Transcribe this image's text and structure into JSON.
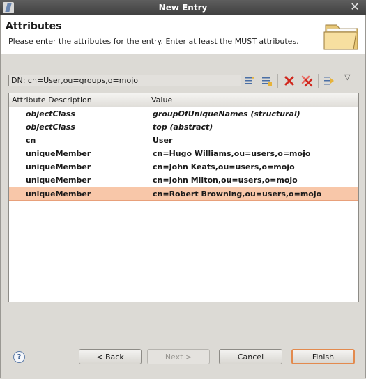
{
  "window": {
    "title": "New Entry",
    "close_glyph": "✕"
  },
  "header": {
    "title": "Attributes",
    "description": "Please enter the attributes for the entry. Enter at least the MUST attributes."
  },
  "dn": {
    "text": "DN: cn=User,ou=groups,o=mojo"
  },
  "toolbar": {
    "icons": [
      "new-attribute-icon",
      "edit-attribute-icon",
      "delete-icon",
      "delete-all-icon",
      "filter-icon",
      "view-menu-icon"
    ],
    "menu_glyph": "▽"
  },
  "table": {
    "columns": [
      "Attribute Description",
      "Value"
    ],
    "rows": [
      {
        "attribute": "objectClass",
        "value": "groupOfUniqueNames (structural)",
        "italic": true
      },
      {
        "attribute": "objectClass",
        "value": "top (abstract)",
        "italic": true
      },
      {
        "attribute": "cn",
        "value": "User",
        "italic": false
      },
      {
        "attribute": "uniqueMember",
        "value": "cn=Hugo Williams,ou=users,o=mojo",
        "italic": false
      },
      {
        "attribute": "uniqueMember",
        "value": "cn=John Keats,ou=users,o=mojo",
        "italic": false
      },
      {
        "attribute": "uniqueMember",
        "value": "cn=John Milton,ou=users,o=mojo",
        "italic": false
      },
      {
        "attribute": "uniqueMember",
        "value": "cn=Robert Browning,ou=users,o=mojo",
        "italic": false,
        "selected": true
      }
    ]
  },
  "buttons": {
    "help": "?",
    "back": "< Back",
    "next": "Next >",
    "cancel": "Cancel",
    "finish": "Finish"
  },
  "colors": {
    "selection": "#f8c7a9",
    "default_button_border": "#e38a4e",
    "titlebar": "#4a4a4a"
  }
}
